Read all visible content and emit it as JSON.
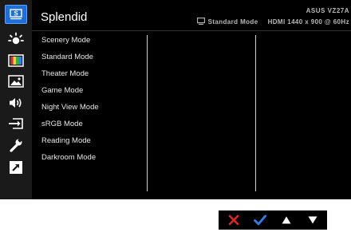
{
  "header": {
    "title": "Splendid",
    "model": "ASUS VZ27A",
    "mode": "Standard Mode",
    "resolution": "HDMI 1440 x 900 @ 60Hz"
  },
  "sidebar": {
    "items": [
      {
        "icon": "splendid-icon",
        "label": "S",
        "active": true
      },
      {
        "icon": "blue-light-filter-icon"
      },
      {
        "icon": "color-icon"
      },
      {
        "icon": "image-icon"
      },
      {
        "icon": "sound-icon"
      },
      {
        "icon": "input-select-icon"
      },
      {
        "icon": "system-setup-icon"
      },
      {
        "icon": "shortcut-icon"
      }
    ]
  },
  "menu": {
    "items": [
      "Scenery Mode",
      "Standard Mode",
      "Theater Mode",
      "Game Mode",
      "Night View Mode",
      "sRGB Mode",
      "Reading Mode",
      "Darkroom Mode"
    ]
  },
  "nav": {
    "buttons": [
      "close-icon",
      "check-icon",
      "up-arrow-icon",
      "down-arrow-icon"
    ]
  },
  "colors": {
    "accent": "#1e6fd9",
    "check": "#2f7fe6",
    "close": "#e0252b"
  }
}
